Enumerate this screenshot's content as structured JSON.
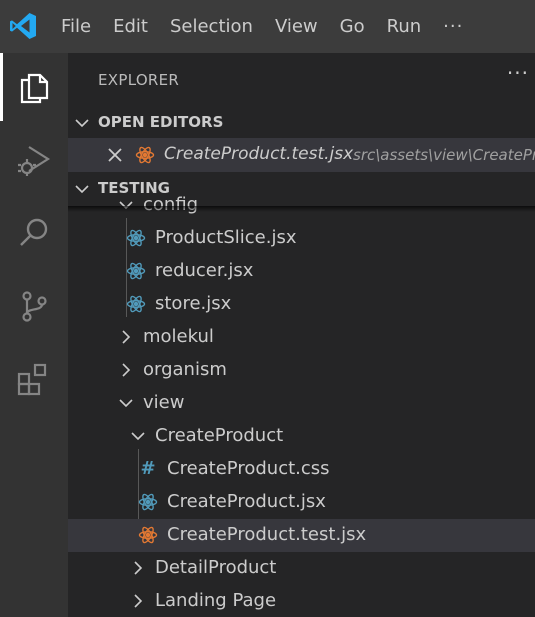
{
  "menu": {
    "items": [
      "File",
      "Edit",
      "Selection",
      "View",
      "Go",
      "Run"
    ],
    "more": "···"
  },
  "activity_bar": {
    "icons": [
      "files-icon",
      "run-debug-icon",
      "search-icon",
      "source-control-icon",
      "extensions-icon"
    ]
  },
  "sidebar": {
    "title": "EXPLORER",
    "more": "···",
    "open_editors": {
      "label": "OPEN EDITORS",
      "items": [
        {
          "name": "CreateProduct.test.jsx",
          "path": "src\\assets\\view\\CreatePr"
        }
      ]
    },
    "workspace": {
      "label": "TESTING",
      "rows": [
        {
          "name": "config",
          "kind": "folder-open"
        },
        {
          "name": "ProductSlice.jsx",
          "kind": "react"
        },
        {
          "name": "reducer.jsx",
          "kind": "react"
        },
        {
          "name": "store.jsx",
          "kind": "react"
        },
        {
          "name": "molekul",
          "kind": "folder-closed"
        },
        {
          "name": "organism",
          "kind": "folder-closed"
        },
        {
          "name": "view",
          "kind": "folder-open"
        },
        {
          "name": "CreateProduct",
          "kind": "folder-open"
        },
        {
          "name": "CreateProduct.css",
          "kind": "css"
        },
        {
          "name": "CreateProduct.jsx",
          "kind": "react"
        },
        {
          "name": "CreateProduct.test.jsx",
          "kind": "react-test"
        },
        {
          "name": "DetailProduct",
          "kind": "folder-closed"
        },
        {
          "name": "Landing Page",
          "kind": "folder-closed"
        }
      ]
    }
  },
  "colors": {
    "titlebar": "#3c3c3c",
    "activitybar": "#333333",
    "sidebar": "#252526",
    "selection": "#37373d",
    "react_blue": "#519aba",
    "react_test_orange": "#e37933",
    "vscode_blue": "#23a9f2"
  }
}
